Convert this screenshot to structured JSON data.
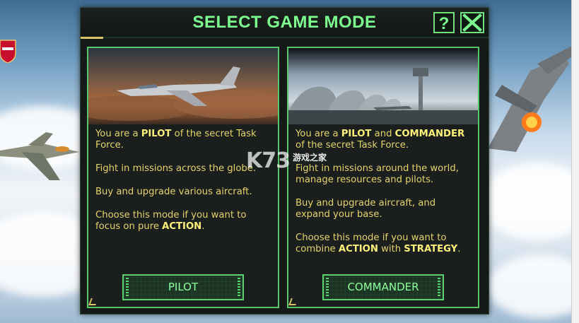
{
  "dialog": {
    "title": "SELECT GAME MODE",
    "help_label": "?",
    "close_label": "✕"
  },
  "pilot_panel": {
    "line1_prefix": "You are a ",
    "line1_highlight": "PILOT",
    "line1_suffix": " of the secret Task Force.",
    "line2": "Fight in missions across the globe.",
    "line3": "Buy and upgrade various aircraft.",
    "line4_prefix": "Choose this mode if you want to focus on pure ",
    "line4_highlight": "ACTION",
    "line4_suffix": ".",
    "button_label": "PILOT"
  },
  "commander_panel": {
    "line1_prefix": "You are a ",
    "line1_highlight1": "PILOT",
    "line1_mid": " and ",
    "line1_highlight2": "COMMANDER",
    "line1_suffix": " of the secret Task Force.",
    "line2": "Fight in missions around the world, manage resources and pilots.",
    "line3": "Buy and upgrade aircraft, and expand your base.",
    "line4_prefix": "Choose this mode if you want to combine ",
    "line4_highlight1": "ACTION",
    "line4_mid": " with ",
    "line4_highlight2": "STRATEGY",
    "line4_suffix": ".",
    "button_label": "COMMANDER"
  },
  "watermark": {
    "main": "K73",
    "sub": "游戏之家"
  },
  "colors": {
    "accent_green": "#7dff8f",
    "text_yellow": "#e3d36a",
    "highlight_yellow": "#fff27a"
  }
}
